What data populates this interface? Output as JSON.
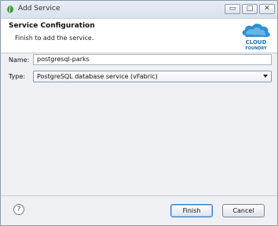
{
  "window": {
    "title": "Add Service",
    "minimize_glyph": "▭",
    "maximize_glyph": "□",
    "close_glyph": "✕"
  },
  "header": {
    "title": "Service Configuration",
    "description": "Finish to add the service.",
    "logo_line1": "CLOUD",
    "logo_line2": "FOUNDRY"
  },
  "form": {
    "name_label": "Name:",
    "name_value": "postgresql-parks",
    "type_label": "Type:",
    "type_value": "PostgreSQL database service (vFabric)"
  },
  "footer": {
    "help_glyph": "?",
    "finish_label": "Finish",
    "cancel_label": "Cancel"
  },
  "colors": {
    "accent": "#3d7bbf",
    "logo_cloud": "#2f8fd1",
    "title_icon": "#3b9a3b"
  },
  "icons": {
    "window_icon": "leaf-icon",
    "help": "help-icon",
    "dropdown": "chevron-down-icon",
    "logo": "cloud-foundry-logo"
  }
}
